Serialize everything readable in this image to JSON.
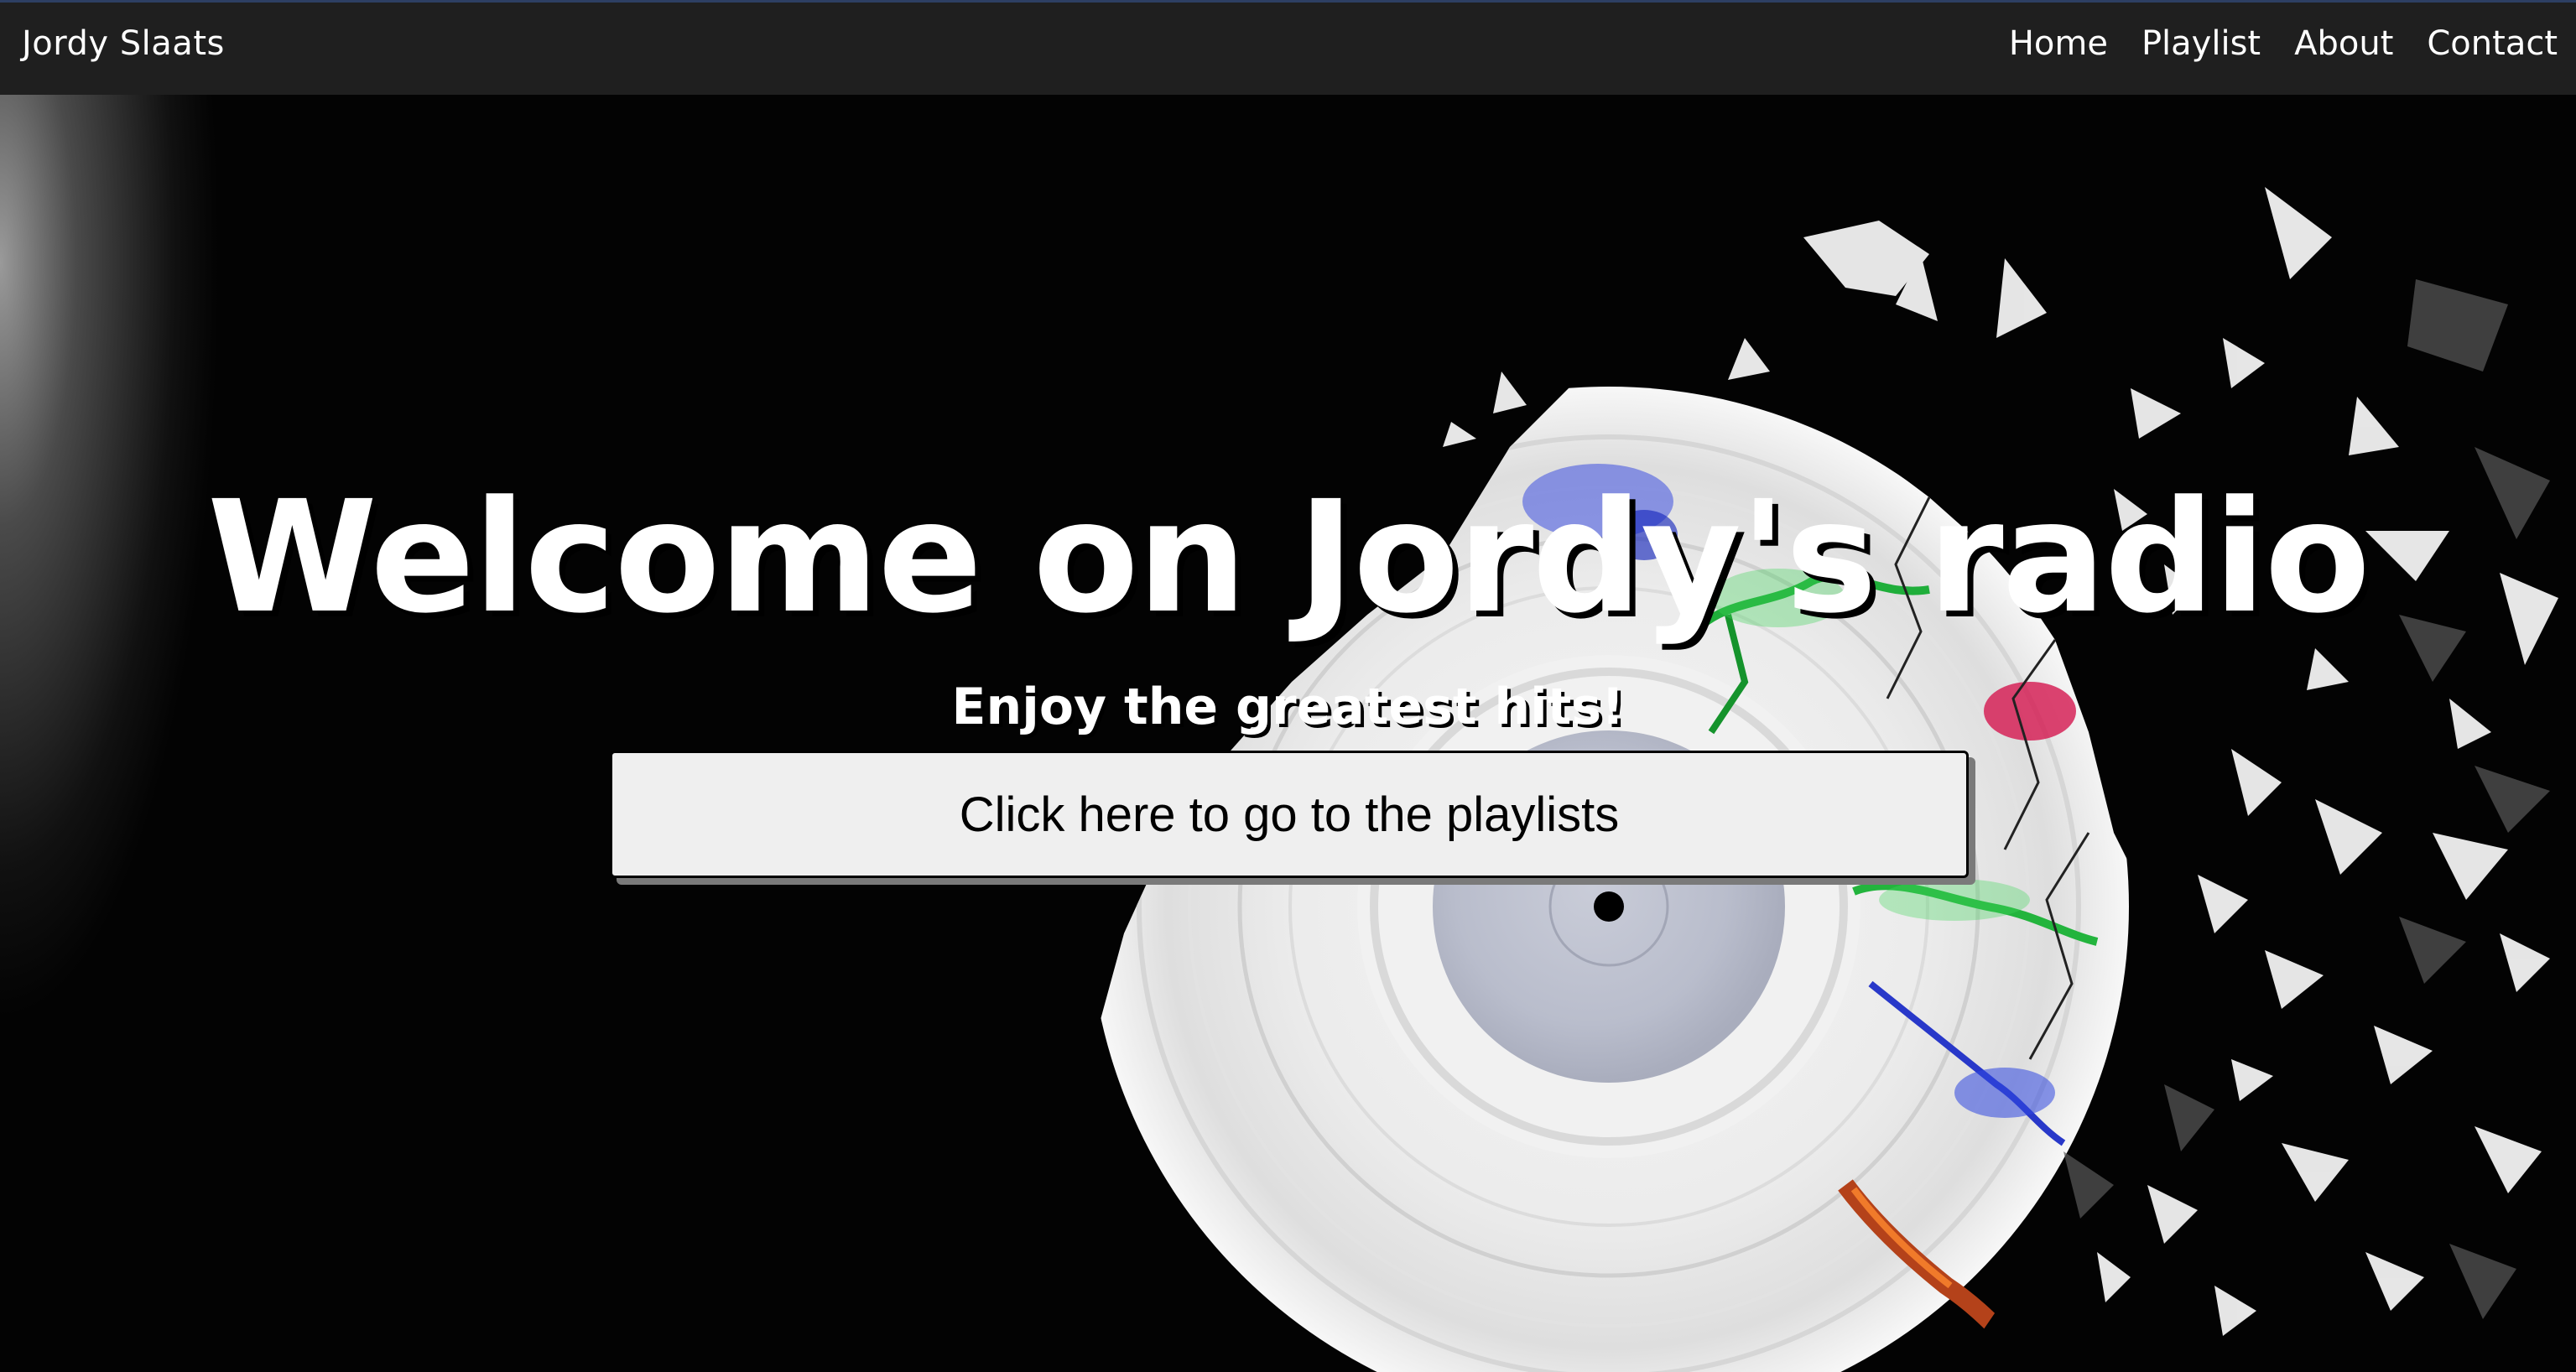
{
  "navbar": {
    "brand": "Jordy Slaats",
    "links": [
      "Home",
      "Playlist",
      "About",
      "Contact"
    ]
  },
  "hero": {
    "title": "Welcome on Jordy's radio",
    "subtitle": "Enjoy the greatest hits!",
    "cta_label": "Click here to go to the playlists"
  },
  "colors": {
    "navbar_bg": "#1f1f1f",
    "navbar_top_border": "#2d3f63",
    "page_bg": "#030303",
    "text": "#ffffff",
    "button_bg": "#efefef"
  }
}
